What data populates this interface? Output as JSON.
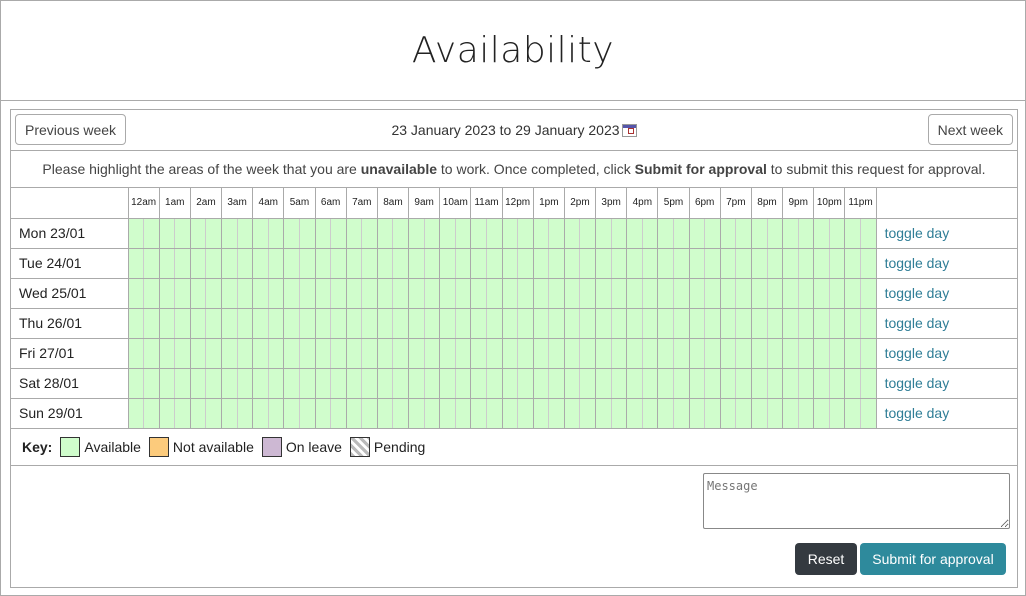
{
  "title": "Availability",
  "nav": {
    "prev": "Previous week",
    "next": "Next week",
    "range": "23 January 2023 to 29 January 2023"
  },
  "instructions": {
    "p1": "Please highlight the areas of the week that you are ",
    "b1": "unavailable",
    "p2": " to work. Once completed, click ",
    "b2": "Submit for approval",
    "p3": " to submit this request for approval."
  },
  "hours": [
    "12am",
    "1am",
    "2am",
    "3am",
    "4am",
    "5am",
    "6am",
    "7am",
    "8am",
    "9am",
    "10am",
    "11am",
    "12pm",
    "1pm",
    "2pm",
    "3pm",
    "4pm",
    "5pm",
    "6pm",
    "7pm",
    "8pm",
    "9pm",
    "10pm",
    "11pm"
  ],
  "days": [
    "Mon 23/01",
    "Tue 24/01",
    "Wed 25/01",
    "Thu 26/01",
    "Fri 27/01",
    "Sat 28/01",
    "Sun 29/01"
  ],
  "toggle_label": "toggle day",
  "key": {
    "label": "Key:",
    "items": [
      {
        "label": "Available",
        "color": "#d0fdcc"
      },
      {
        "label": "Not available",
        "color": "#fccb7c"
      },
      {
        "label": "On leave",
        "color": "#cdb8d3"
      },
      {
        "label": "Pending",
        "color": "hatched"
      }
    ]
  },
  "message": {
    "placeholder": "Message",
    "value": ""
  },
  "buttons": {
    "reset": "Reset",
    "submit": "Submit for approval"
  }
}
